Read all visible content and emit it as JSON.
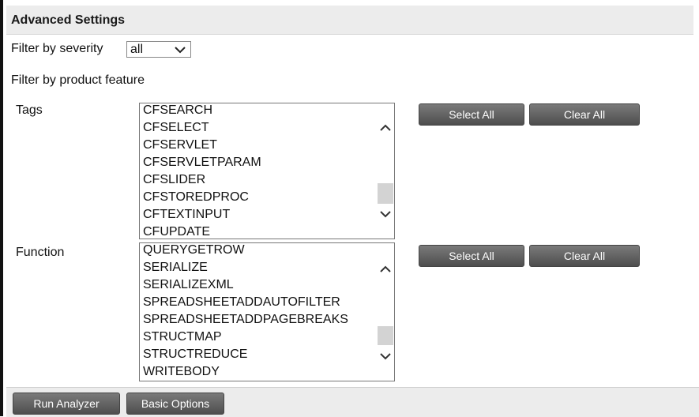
{
  "header": {
    "title": "Advanced Settings"
  },
  "severity": {
    "label": "Filter by severity",
    "value": "all"
  },
  "feature": {
    "label": "Filter by product feature"
  },
  "tags": {
    "label": "Tags",
    "items": [
      "CFSEARCH",
      "CFSELECT",
      "CFSERVLET",
      "CFSERVLETPARAM",
      "CFSLIDER",
      "CFSTOREDPROC",
      "CFTEXTINPUT",
      "CFUPDATE"
    ],
    "select_all": "Select All",
    "clear_all": "Clear All"
  },
  "function": {
    "label": "Function",
    "items": [
      "QUERYGETROW",
      "SERIALIZE",
      "SERIALIZEXML",
      "SPREADSHEETADDAUTOFILTER",
      "SPREADSHEETADDPAGEBREAKS",
      "STRUCTMAP",
      "STRUCTREDUCE",
      "WRITEBODY"
    ],
    "select_all": "Select All",
    "clear_all": "Clear All"
  },
  "footer": {
    "run_analyzer": "Run Analyzer",
    "basic_options": "Basic Options"
  }
}
